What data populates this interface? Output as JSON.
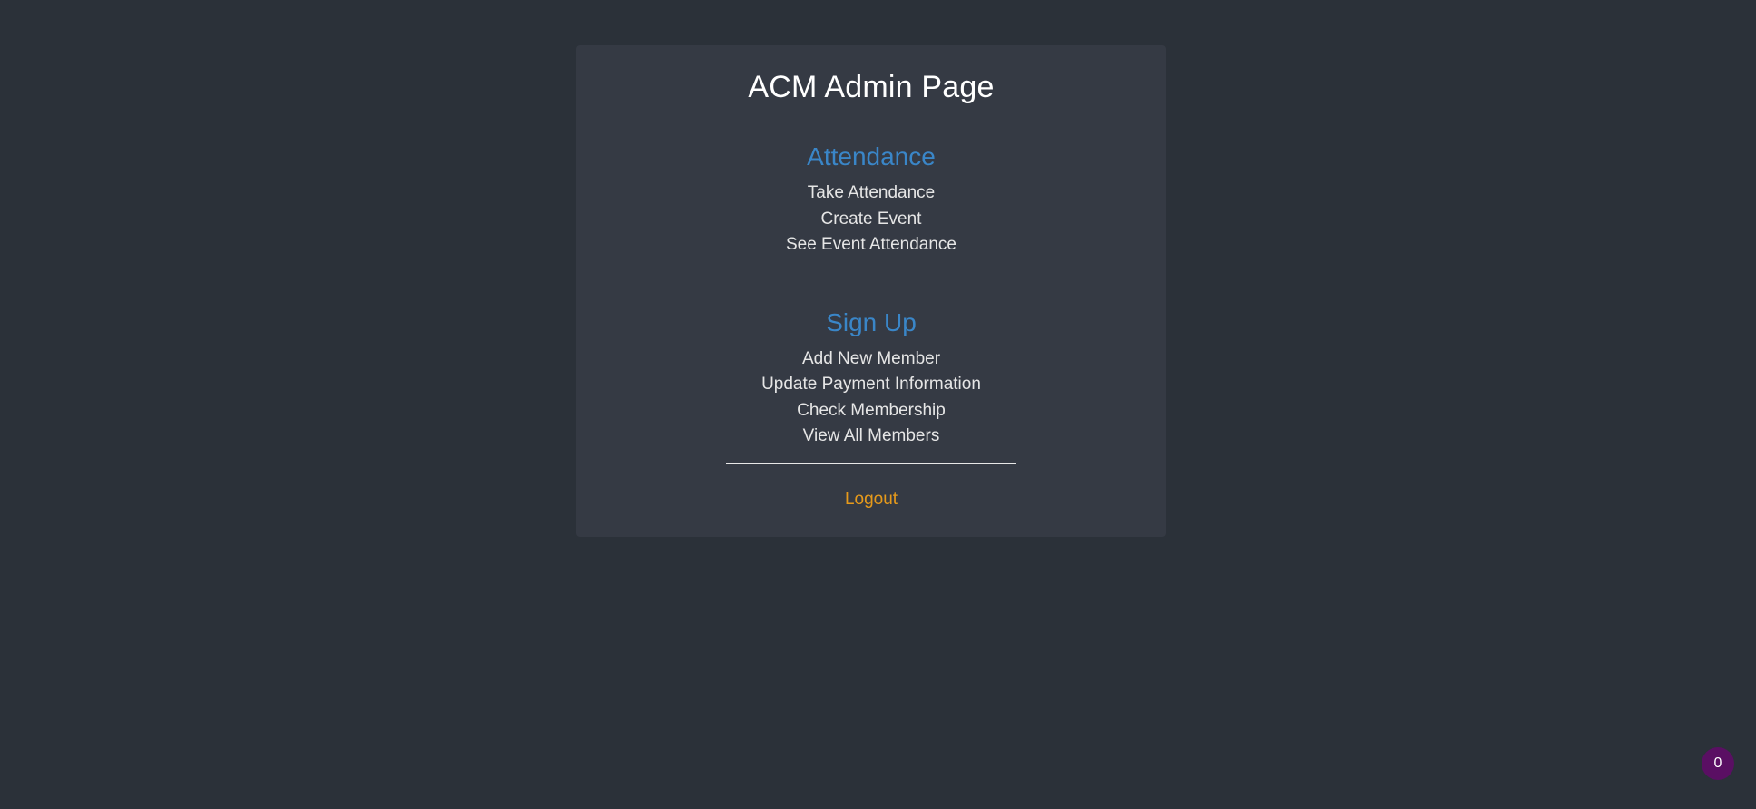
{
  "page": {
    "title": "ACM Admin Page"
  },
  "attendance": {
    "heading": "Attendance",
    "links": [
      "Take Attendance",
      "Create Event",
      "See Event Attendance"
    ]
  },
  "signup": {
    "heading": "Sign Up",
    "links": [
      "Add New Member",
      "Update Payment Information",
      "Check Membership",
      "View All Members"
    ]
  },
  "logout": {
    "label": "Logout"
  },
  "badge": {
    "count": "0"
  },
  "colors": {
    "background": "#2b3139",
    "card": "#353a44",
    "section_heading": "#3a86c8",
    "logout": "#e69a1b",
    "badge": "#5a0f63"
  }
}
